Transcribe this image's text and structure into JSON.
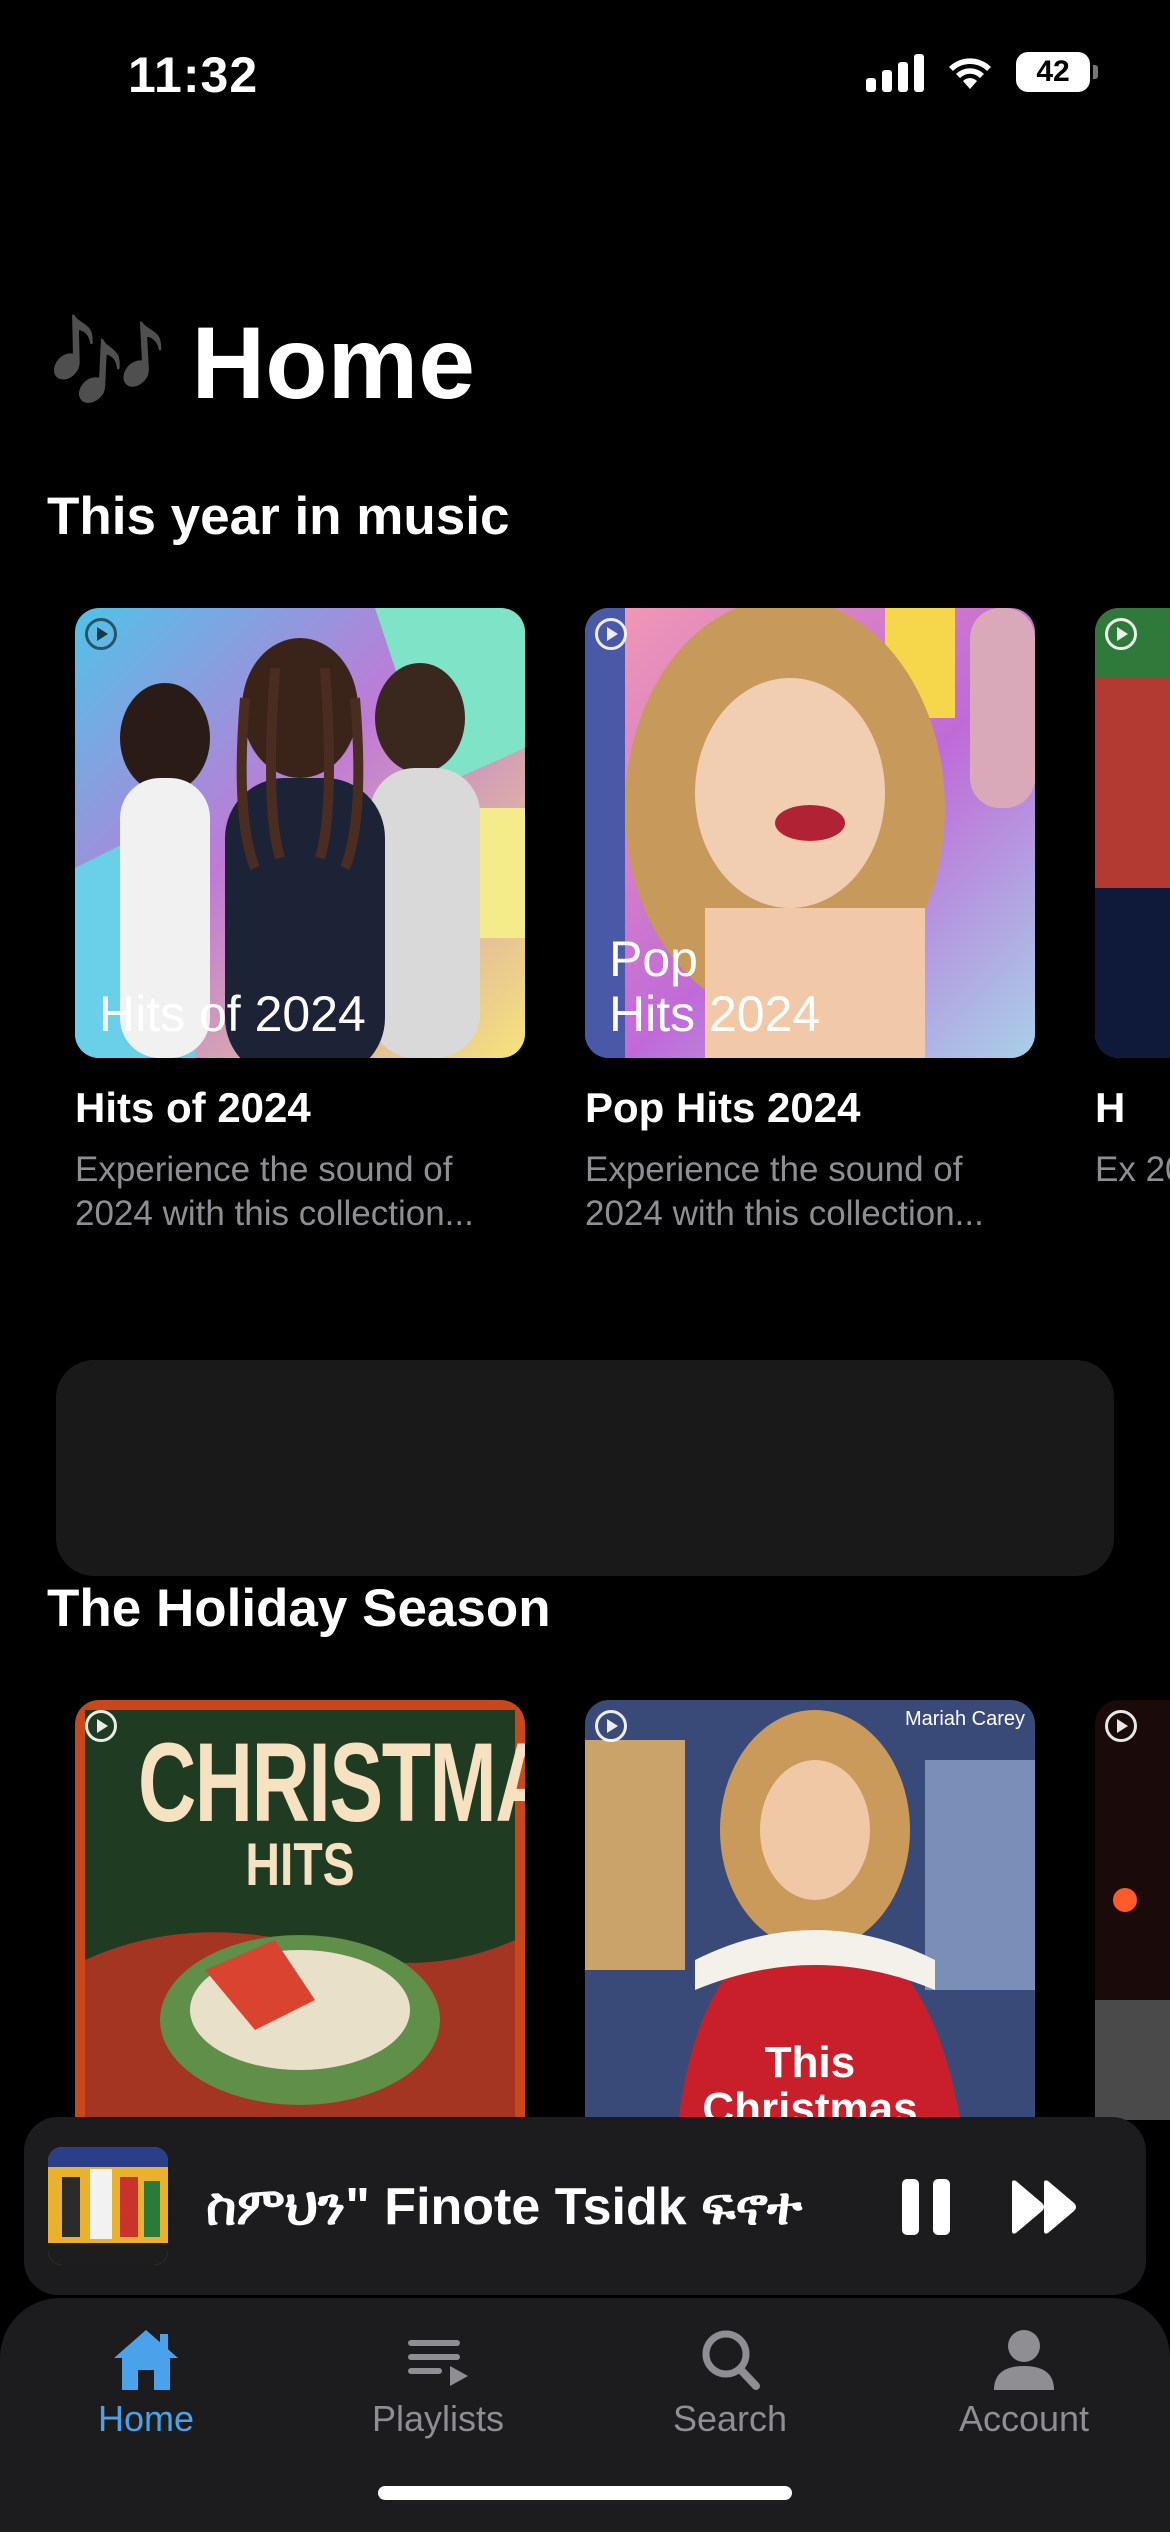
{
  "status_bar": {
    "time": "11:32",
    "battery": "42"
  },
  "header": {
    "emoji": "🎶",
    "title": "Home"
  },
  "sections": [
    {
      "title": "This year in music",
      "cards": [
        {
          "cover_label": "Hits of 2024",
          "title": "Hits of 2024",
          "description": "Experience the sound of 2024 with this collection..."
        },
        {
          "cover_label_1": "Pop",
          "cover_label_2": "Hits 2024",
          "title": "Pop Hits 2024",
          "description": "Experience the sound of 2024 with this collection..."
        },
        {
          "title": "H",
          "description": "Ex 20"
        }
      ]
    },
    {
      "title": "The Holiday Season",
      "cards": [
        {
          "cover_title_1": "CHRISTMAS",
          "cover_title_2": "HITS"
        },
        {
          "cover_artist": "Mariah Carey",
          "cover_title_1": "This",
          "cover_title_2": "Christmas"
        },
        {}
      ]
    }
  ],
  "mini_player": {
    "track_title": "ስምህን\" Finote Tsidk ፍኖተ"
  },
  "tab_bar": {
    "items": [
      {
        "label": "Home",
        "icon": "house-icon",
        "active": true
      },
      {
        "label": "Playlists",
        "icon": "playlist-icon"
      },
      {
        "label": "Search",
        "icon": "magnifier-icon"
      },
      {
        "label": "Account",
        "icon": "person-icon"
      }
    ]
  },
  "colors": {
    "accent": "#4aa3ea",
    "background": "#000000",
    "surface": "#1c1c1e",
    "secondary_text": "#8e8e93"
  }
}
